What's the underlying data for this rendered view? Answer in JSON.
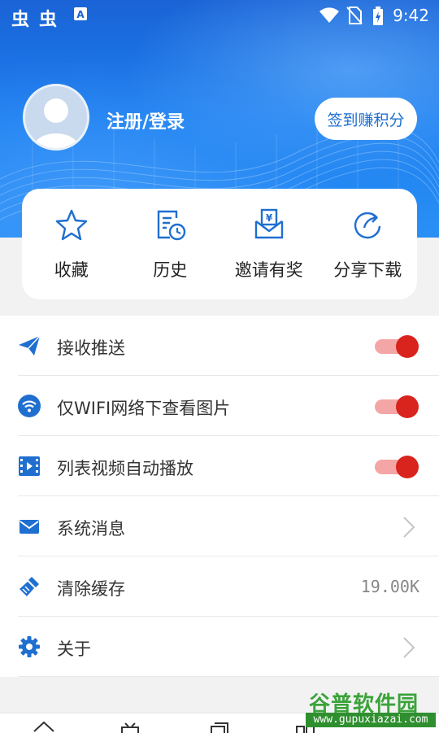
{
  "status_bar": {
    "app_icons": [
      "虫",
      "虫"
    ],
    "time": "9:42"
  },
  "profile": {
    "login_text": "注册/登录",
    "checkin_button": "签到赚积分"
  },
  "quick_actions": [
    {
      "label": "收藏",
      "icon": "star-icon"
    },
    {
      "label": "历史",
      "icon": "history-icon"
    },
    {
      "label": "邀请有奖",
      "icon": "invite-reward-icon"
    },
    {
      "label": "分享下载",
      "icon": "share-icon"
    }
  ],
  "settings": [
    {
      "label": "接收推送",
      "icon": "paper-plane-icon",
      "control": "toggle",
      "on": true
    },
    {
      "label": "仅WIFI网络下查看图片",
      "icon": "wifi-icon",
      "control": "toggle",
      "on": true
    },
    {
      "label": "列表视频自动播放",
      "icon": "video-icon",
      "control": "toggle",
      "on": true
    },
    {
      "label": "系统消息",
      "icon": "mail-icon",
      "control": "chevron"
    },
    {
      "label": "清除缓存",
      "icon": "broom-icon",
      "control": "value",
      "value": "19.00K"
    },
    {
      "label": "关于",
      "icon": "gear-icon",
      "control": "chevron"
    }
  ],
  "watermark": {
    "title": "谷普软件园",
    "url": "www.gupuxiazai.com"
  },
  "colors": {
    "accent": "#1f6fd0",
    "toggle_on": "#d9231d",
    "toggle_track": "#f4a6a6",
    "icon_blue": "#1f6fd0"
  }
}
